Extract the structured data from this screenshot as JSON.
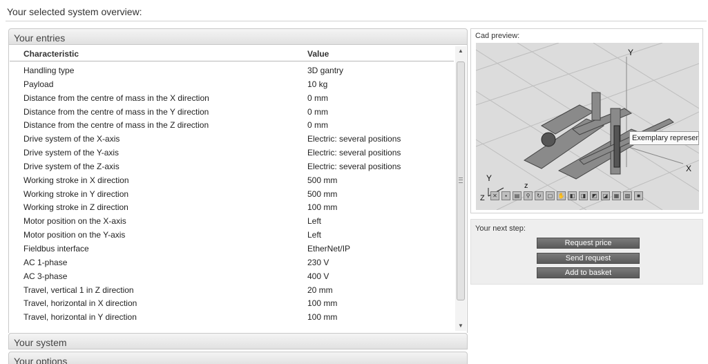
{
  "page_title": "Your selected system overview:",
  "accordion": {
    "entries_label": "Your entries",
    "system_label": "Your system",
    "options_label": "Your options"
  },
  "table": {
    "headers": {
      "characteristic": "Characteristic",
      "value": "Value"
    },
    "rows": [
      {
        "characteristic": "Handling type",
        "value": "3D gantry"
      },
      {
        "characteristic": "Payload",
        "value": "10 kg"
      },
      {
        "characteristic": "Distance from the centre of mass in the X direction",
        "value": "0 mm"
      },
      {
        "characteristic": "Distance from the centre of mass in the Y direction",
        "value": "0 mm"
      },
      {
        "characteristic": "Distance from the centre of mass in the Z direction",
        "value": "0 mm"
      },
      {
        "characteristic": "Drive system of the X-axis",
        "value": "Electric: several positions"
      },
      {
        "characteristic": "Drive system of the Y-axis",
        "value": "Electric: several positions"
      },
      {
        "characteristic": "Drive system of the Z-axis",
        "value": "Electric: several positions"
      },
      {
        "characteristic": "Working stroke in X direction",
        "value": "500 mm"
      },
      {
        "characteristic": "Working stroke in Y direction",
        "value": "500 mm"
      },
      {
        "characteristic": "Working stroke in Z direction",
        "value": "100 mm"
      },
      {
        "characteristic": "Motor position on the X-axis",
        "value": "Left"
      },
      {
        "characteristic": "Motor position on the Y-axis",
        "value": "Left"
      },
      {
        "characteristic": "Fieldbus interface",
        "value": "EtherNet/IP"
      },
      {
        "characteristic": "AC 1-phase",
        "value": "230 V"
      },
      {
        "characteristic": "AC 3-phase",
        "value": "400 V"
      },
      {
        "characteristic": "Travel, vertical 1 in Z direction",
        "value": "20 mm"
      },
      {
        "characteristic": "Travel, horizontal in X direction",
        "value": "100 mm"
      },
      {
        "characteristic": "Travel, horizontal in Y direction",
        "value": "100 mm"
      }
    ]
  },
  "cad": {
    "label": "Cad preview:",
    "tooltip": "Exemplary representation",
    "axis_labels": {
      "y_top": "Y",
      "x_right": "X",
      "y_corner": "Y",
      "z_corner": "z",
      "z_left": "Z"
    }
  },
  "next_step": {
    "label": "Your next step:",
    "buttons": {
      "request_price": "Request price",
      "send_request": "Send request",
      "add_to_basket": "Add to basket"
    }
  },
  "icons": {
    "scroll_up": "scroll-up-arrow-icon",
    "scroll_down": "scroll-down-arrow-icon",
    "toolbar": [
      "view-cube-icon",
      "iso-view-icon",
      "front-view-icon",
      "zoom-icon",
      "rotate-icon",
      "zoom-window-icon",
      "pan-icon",
      "view-1-icon",
      "view-2-icon",
      "view-3-icon",
      "view-4-icon",
      "view-5-icon",
      "view-6-icon",
      "view-7-icon"
    ]
  },
  "colors": {
    "button_bg": "#666666",
    "header_bg": "#e8e8e8",
    "panel_bg": "#eeeeee"
  }
}
